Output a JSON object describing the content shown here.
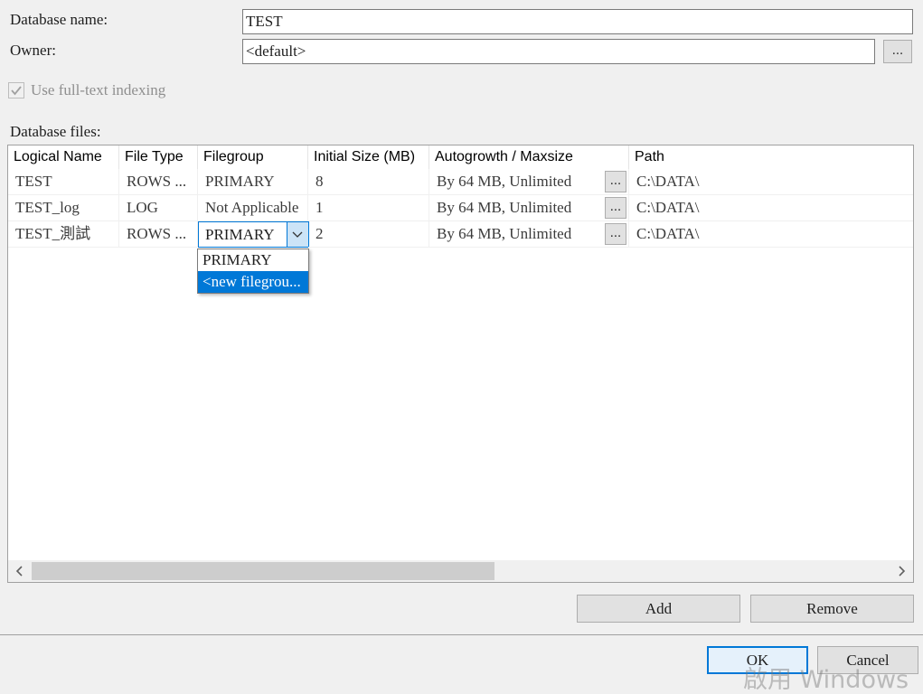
{
  "form": {
    "database_name_label": "Database name:",
    "database_name_value": "TEST",
    "owner_label": "Owner:",
    "owner_value": "<default>",
    "owner_browse_label": "...",
    "fulltext_label": "Use full-text indexing",
    "fulltext_checked": true,
    "database_files_label": "Database files:"
  },
  "grid": {
    "columns": [
      "Logical Name",
      "File Type",
      "Filegroup",
      "Initial Size (MB)",
      "Autogrowth / Maxsize",
      "Path"
    ],
    "rows": [
      {
        "logical_name": "TEST",
        "file_type": "ROWS ...",
        "filegroup": "PRIMARY",
        "initial_size": "8",
        "autogrowth": "By 64 MB, Unlimited",
        "autogrowth_button": "...",
        "path": "C:\\DATA\\"
      },
      {
        "logical_name": "TEST_log",
        "file_type": "LOG",
        "filegroup": "Not Applicable",
        "initial_size": "1",
        "autogrowth": "By 64 MB, Unlimited",
        "autogrowth_button": "...",
        "path": "C:\\DATA\\"
      },
      {
        "logical_name": "TEST_測試",
        "file_type": "ROWS ...",
        "filegroup": "PRIMARY",
        "initial_size": "2",
        "autogrowth": "By 64 MB, Unlimited",
        "autogrowth_button": "...",
        "path": "C:\\DATA\\"
      }
    ],
    "filegroup_dropdown": {
      "options": [
        "PRIMARY",
        "<new filegrou..."
      ],
      "highlighted_index": 1
    },
    "scroll_left_icon": "chevron-left-icon",
    "scroll_right_icon": "chevron-right-icon",
    "scroll_thumb_fraction": 0.54
  },
  "buttons": {
    "add": "Add",
    "remove": "Remove",
    "ok": "OK",
    "cancel": "Cancel"
  },
  "watermark": "啟用 Windows",
  "colors": {
    "accent": "#0078d7",
    "window_bg": "#f0f0f0",
    "button_bg": "#e1e1e1"
  }
}
